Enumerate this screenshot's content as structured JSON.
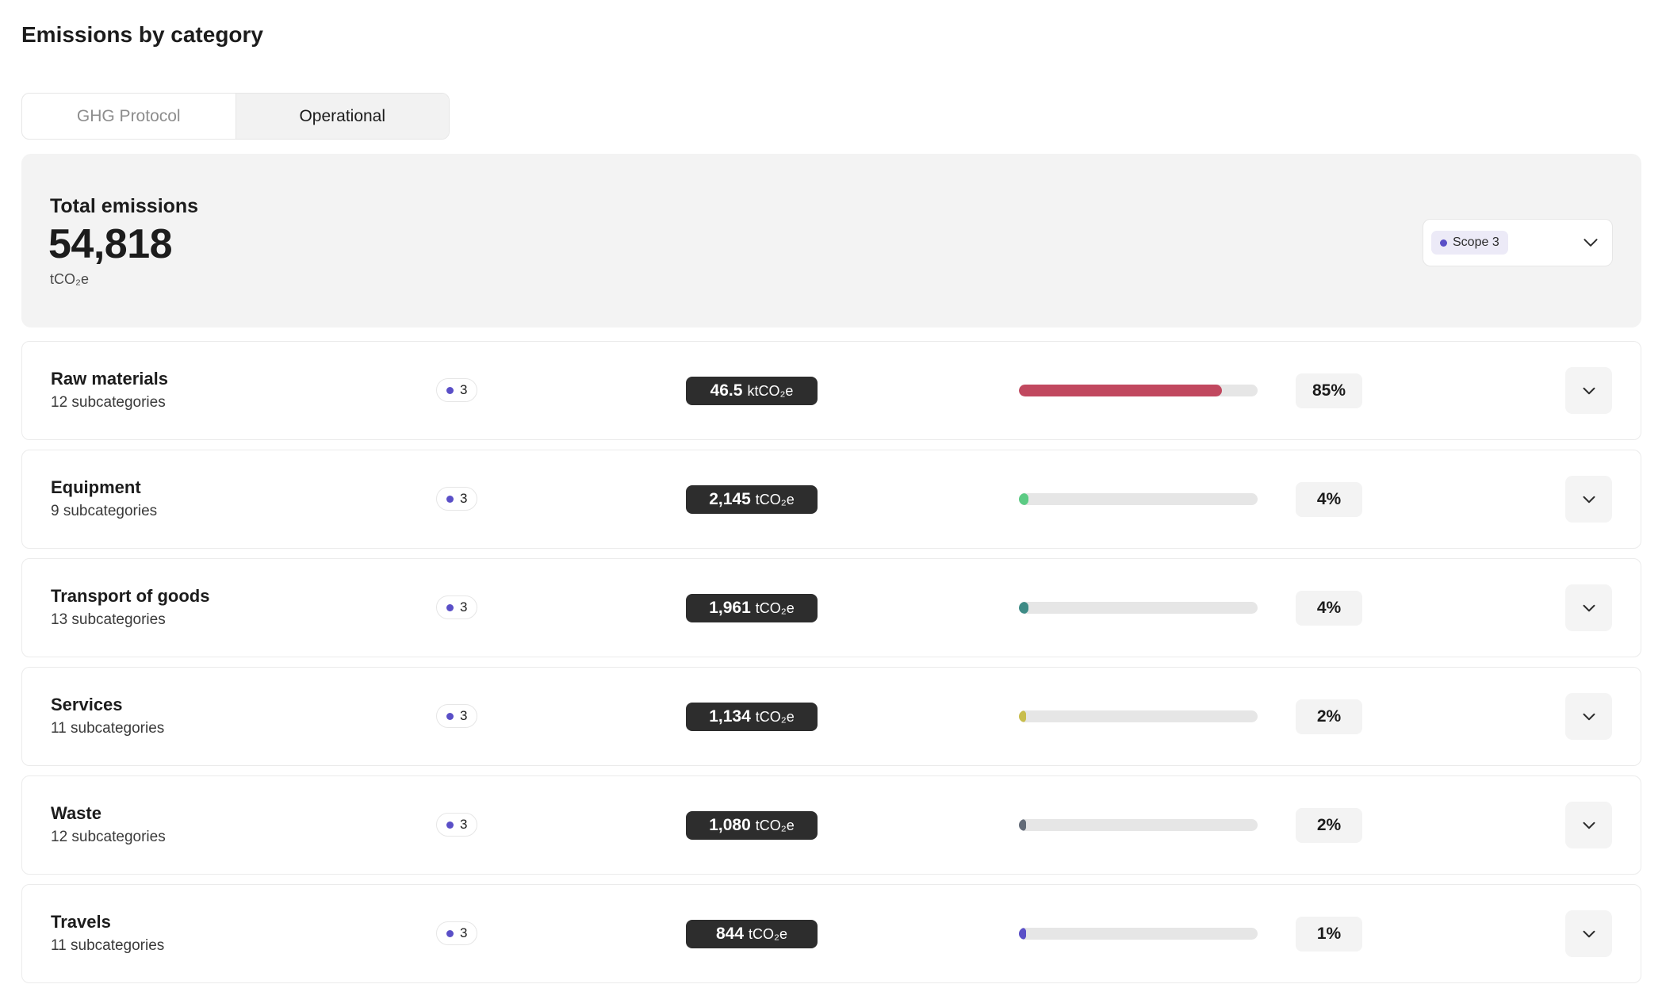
{
  "page": {
    "title": "Emissions by category"
  },
  "tabs": [
    {
      "label": "GHG Protocol",
      "active": false
    },
    {
      "label": "Operational",
      "active": true
    }
  ],
  "summary": {
    "label": "Total emissions",
    "value": "54,818",
    "unit": "tCO₂e",
    "scope_select": {
      "selected": "Scope 3",
      "dot_color": "#5a4fc7"
    }
  },
  "icons": {
    "expand": "chevron-down-icon",
    "scope_dot": "scope-dot-icon"
  },
  "categories": [
    {
      "name": "Raw materials",
      "subcategories": "12 subcategories",
      "scope": "3",
      "value": "46.5",
      "unit": "ktCO₂e",
      "share": 0.85,
      "percent": "85%",
      "color": "#c1485f"
    },
    {
      "name": "Equipment",
      "subcategories": "9 subcategories",
      "scope": "3",
      "value": "2,145",
      "unit": "tCO₂e",
      "share": 0.04,
      "percent": "4%",
      "color": "#5ccb84"
    },
    {
      "name": "Transport of goods",
      "subcategories": "13 subcategories",
      "scope": "3",
      "value": "1,961",
      "unit": "tCO₂e",
      "share": 0.04,
      "percent": "4%",
      "color": "#3e8b86"
    },
    {
      "name": "Services",
      "subcategories": "11 subcategories",
      "scope": "3",
      "value": "1,134",
      "unit": "tCO₂e",
      "share": 0.02,
      "percent": "2%",
      "color": "#c8bd4c"
    },
    {
      "name": "Waste",
      "subcategories": "12 subcategories",
      "scope": "3",
      "value": "1,080",
      "unit": "tCO₂e",
      "share": 0.02,
      "percent": "2%",
      "color": "#636b78"
    },
    {
      "name": "Travels",
      "subcategories": "11 subcategories",
      "scope": "3",
      "value": "844",
      "unit": "tCO₂e",
      "share": 0.01,
      "percent": "1%",
      "color": "#5a4fc7"
    }
  ]
}
